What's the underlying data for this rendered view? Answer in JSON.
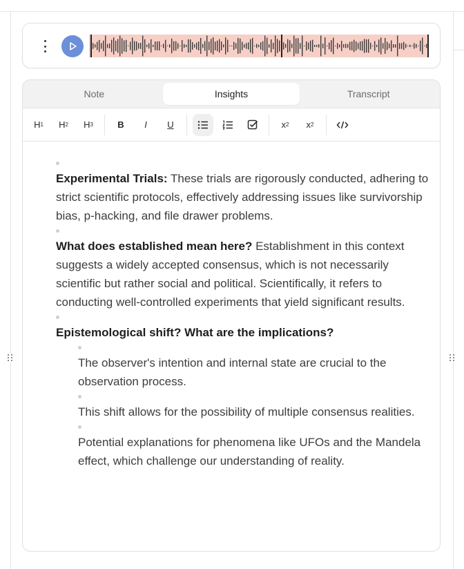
{
  "tabs": [
    {
      "label": "Note",
      "active": false
    },
    {
      "label": "Insights",
      "active": true
    },
    {
      "label": "Transcript",
      "active": false
    }
  ],
  "toolbar": {
    "h1": "H",
    "h1_sub": "1",
    "h2": "H",
    "h2_sub": "2",
    "h3": "H",
    "h3_sub": "3",
    "bold": "B",
    "italic": "I",
    "underline": "U",
    "subscript": "x",
    "subscript_mark": "2",
    "superscript": "x",
    "superscript_mark": "2"
  },
  "content": {
    "items": [
      {
        "bold": "Experimental Trials:",
        "text": " These trials are rigorously conducted, adhering to strict scientific protocols, effectively addressing issues like survivorship bias, p-hacking, and file drawer problems."
      },
      {
        "bold": "What does established mean here?",
        "text": " Establishment in this context suggests a widely accepted consensus, which is not necessarily scientific but rather social and political. Scientifically, it refers to conducting well-controlled experiments that yield significant results."
      },
      {
        "bold": "Epistemological shift? What are the implications?",
        "text": ""
      }
    ],
    "nested": [
      "The observer's intention and internal state are crucial to the observation process.",
      "This shift allows for the possibility of multiple consensus realities.",
      "Potential explanations for phenomena like UFOs and the Mandela effect, which challenge our understanding of reality."
    ]
  },
  "colors": {
    "play_button": "#6b8fd8",
    "waveform_bg": "#f6cfc6",
    "waveform_bar": "#3a3a3a"
  }
}
